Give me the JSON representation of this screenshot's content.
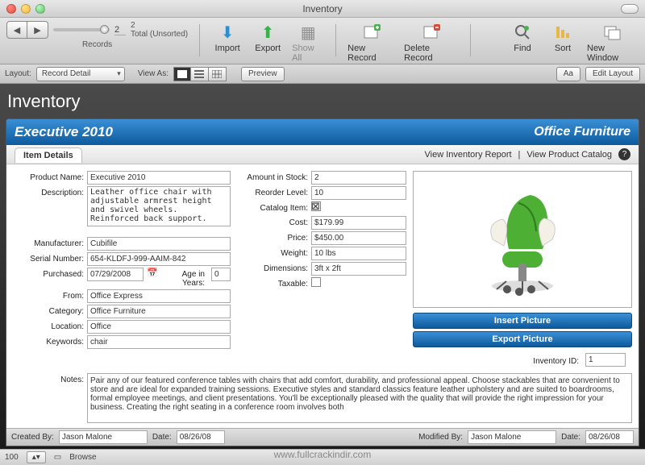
{
  "window": {
    "title": "Inventory"
  },
  "toolbar": {
    "records_label": "Records",
    "slider_value": "2",
    "total_label": "Total (Unsorted)",
    "total_count": "2",
    "import": "Import",
    "export": "Export",
    "show_all": "Show All",
    "new_record": "New Record",
    "delete_record": "Delete Record",
    "find": "Find",
    "sort": "Sort",
    "new_window": "New Window"
  },
  "layoutbar": {
    "layout_label": "Layout:",
    "layout_value": "Record Detail",
    "viewas_label": "View As:",
    "preview": "Preview",
    "aa": "Aa",
    "edit_layout": "Edit Layout"
  },
  "page": {
    "title": "Inventory",
    "product_header": "Executive 2010",
    "category_header": "Office Furniture",
    "tab": "Item Details",
    "links": {
      "report": "View Inventory Report",
      "catalog": "View Product Catalog"
    }
  },
  "fields": {
    "product_name_lbl": "Product Name:",
    "product_name": "Executive 2010",
    "description_lbl": "Description:",
    "description": "Leather office chair with adjustable armrest height and swivel wheels. Reinforced back support.",
    "manufacturer_lbl": "Manufacturer:",
    "manufacturer": "Cubifile",
    "serial_lbl": "Serial Number:",
    "serial": "654-KLDFJ-999-AAIM-842",
    "purchased_lbl": "Purchased:",
    "purchased": "07/29/2008",
    "age_lbl": "Age in Years:",
    "age": "0",
    "from_lbl": "From:",
    "from": "Office Express",
    "category_lbl": "Category:",
    "category": "Office Furniture",
    "location_lbl": "Location:",
    "location": "Office",
    "keywords_lbl": "Keywords:",
    "keywords": "chair",
    "amount_lbl": "Amount in Stock:",
    "amount": "2",
    "reorder_lbl": "Reorder Level:",
    "reorder": "10",
    "catalog_item_lbl": "Catalog Item:",
    "cost_lbl": "Cost:",
    "cost": "$179.99",
    "price_lbl": "Price:",
    "price": "$450.00",
    "weight_lbl": "Weight:",
    "weight": "10 lbs",
    "dimensions_lbl": "Dimensions:",
    "dimensions": "3ft x 2ft",
    "taxable_lbl": "Taxable:",
    "notes_lbl": "Notes:",
    "notes": "Pair any of our featured conference tables with chairs that add comfort, durability, and professional appeal. Choose stackables that are convenient to store and are ideal for expanded training sessions. Executive styles and standard classics feature leather upholstery and are suited to boardrooms, formal employee meetings, and client presentations. You'll be exceptionally pleased with the quality that will provide the right impression for your business. Creating the right seating in a conference room involves both",
    "insert_pic": "Insert Picture",
    "export_pic": "Export Picture",
    "inventory_id_lbl": "Inventory ID:",
    "inventory_id": "1"
  },
  "footer": {
    "created_by_lbl": "Created By:",
    "created_by": "Jason Malone",
    "created_date_lbl": "Date:",
    "created_date": "08/26/08",
    "modified_by_lbl": "Modified By:",
    "modified_by": "Jason Malone",
    "modified_date_lbl": "Date:",
    "modified_date": "08/26/08"
  },
  "status": {
    "zoom": "100",
    "mode": "Browse"
  },
  "watermark": "www.fullcrackindir.com"
}
